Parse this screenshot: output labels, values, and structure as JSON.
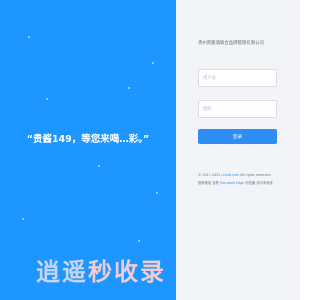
{
  "slogan": "“贵酱149，等您来喝…彩。”",
  "login": {
    "company_name": "贵州贵酱酒联合品牌管理有限公司",
    "username_placeholder": "用户名",
    "password_placeholder": "密码",
    "submit_label": "登录"
  },
  "footer": {
    "copyright_prefix": "© 2017-2025 ",
    "copyright_link": "ccsoft.com",
    "copyright_suffix": " All rights reserved.",
    "browser_prefix": "推荐使用 谷歌 ",
    "browser_link": "Microsoft Edge",
    "browser_suffix": " 浏览器 访问本系统"
  },
  "watermark": {
    "part1": "逍遥",
    "part2": "秒收录"
  },
  "colors": {
    "left_bg": "#1e96ff",
    "right_bg": "#f3f4f8",
    "button": "#2f8ef6",
    "watermark_blue": "#c9d3f3",
    "watermark_pink": "#f2ccd4"
  }
}
